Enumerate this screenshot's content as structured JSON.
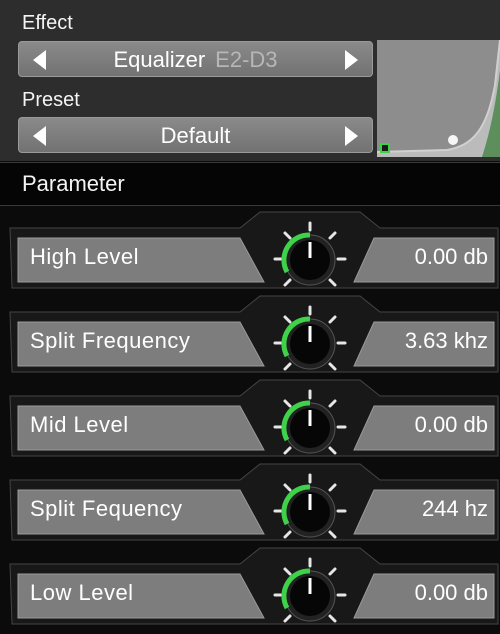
{
  "effect": {
    "label": "Effect",
    "name": "Equalizer",
    "code": "E2-D3"
  },
  "preset": {
    "label": "Preset",
    "value": "Default"
  },
  "parameters": {
    "header": "Parameter",
    "items": [
      {
        "name": "High Level",
        "value": "0.00 db"
      },
      {
        "name": "Split Frequency",
        "value": "3.63 khz"
      },
      {
        "name": "Mid Level",
        "value": "0.00 db"
      },
      {
        "name": "Split Fequency",
        "value": "244 hz"
      },
      {
        "name": "Low Level",
        "value": "0.00 db"
      }
    ]
  },
  "colors": {
    "accent": "#3fd14a",
    "panel": "#2d2d2d",
    "control": "#7d7d7d"
  }
}
